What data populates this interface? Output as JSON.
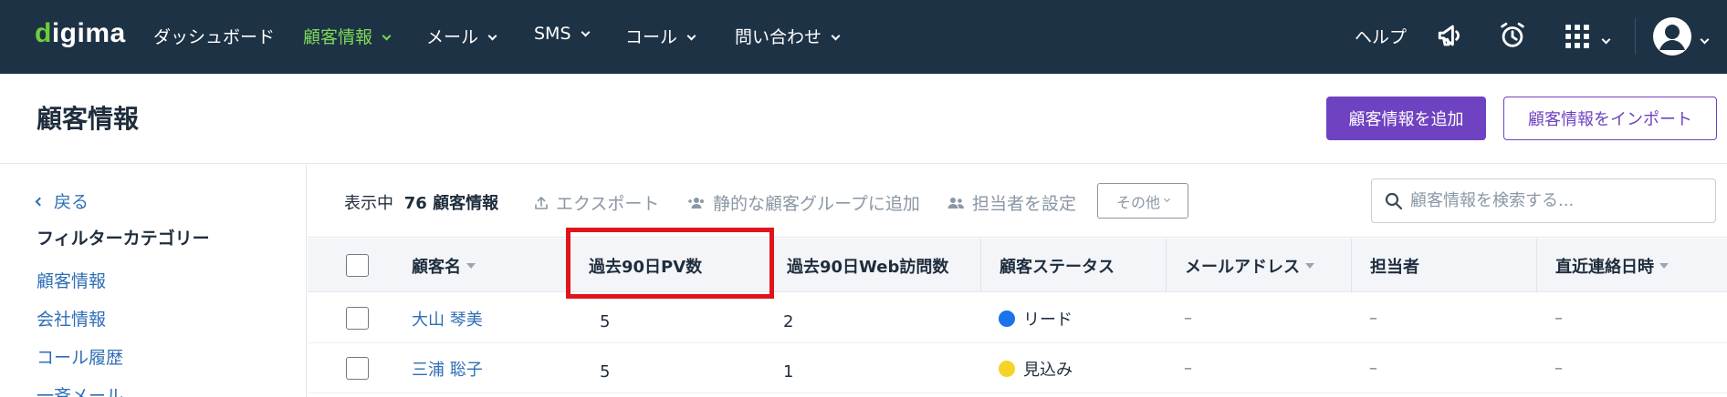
{
  "nav": {
    "logo": "digima",
    "items": [
      {
        "label": "ダッシュボード",
        "caret": false,
        "active": false
      },
      {
        "label": "顧客情報",
        "caret": true,
        "active": true
      },
      {
        "label": "メール",
        "caret": true,
        "active": false
      },
      {
        "label": "SMS",
        "caret": true,
        "active": false
      },
      {
        "label": "コール",
        "caret": true,
        "active": false
      },
      {
        "label": "問い合わせ",
        "caret": true,
        "active": false
      }
    ],
    "help": "ヘルプ",
    "icons": [
      "megaphone-icon",
      "alarm-clock-icon",
      "apps-grid-icon",
      "user-avatar-icon"
    ]
  },
  "page": {
    "title": "顧客情報",
    "add_button": "顧客情報を追加",
    "import_button": "顧客情報をインポート"
  },
  "sidebar": {
    "back": "戻る",
    "heading": "フィルターカテゴリー",
    "items": [
      "顧客情報",
      "会社情報",
      "コール履歴",
      "一斉メール"
    ]
  },
  "toolbar": {
    "showing_label": "表示中",
    "count": "76",
    "count_unit": "顧客情報",
    "export": "エクスポート",
    "add_to_group": "静的な顧客グループに追加",
    "assign_owner": "担当者を設定",
    "more": "その他",
    "search_placeholder": "顧客情報を検索する..."
  },
  "table": {
    "columns": [
      {
        "label": "顧客名",
        "sortable": true
      },
      {
        "label": "過去90日PV数",
        "sortable": false
      },
      {
        "label": "過去90日Web訪問数",
        "sortable": false
      },
      {
        "label": "顧客ステータス",
        "sortable": false
      },
      {
        "label": "メールアドレス",
        "sortable": true
      },
      {
        "label": "担当者",
        "sortable": false
      },
      {
        "label": "直近連絡日時",
        "sortable": true
      }
    ],
    "rows": [
      {
        "name": "大山 琴美",
        "pv": "5",
        "visits": "2",
        "status": "リード",
        "status_color": "#1a73e8",
        "email": "–",
        "owner": "–",
        "last_contact": "–"
      },
      {
        "name": "三浦 聡子",
        "pv": "5",
        "visits": "1",
        "status": "見込み",
        "status_color": "#f5d328",
        "email": "–",
        "owner": "–",
        "last_contact": "–"
      }
    ]
  },
  "colors": {
    "nav_bg": "#1e3246",
    "nav_active": "#7ed957",
    "primary": "#6f42c1",
    "link": "#2f6eb5",
    "highlight_border": "#e0151b"
  }
}
